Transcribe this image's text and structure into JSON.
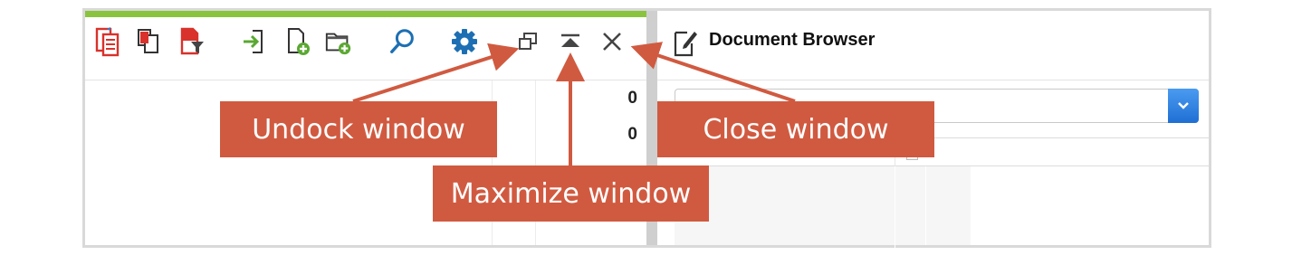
{
  "left_panel": {
    "counts": [
      "0",
      "0"
    ],
    "toolbar_icons": [
      "document-list-icon",
      "copy-documents-icon",
      "filter-documents-icon",
      "import-icon",
      "new-document-icon",
      "new-folder-icon",
      "search-icon",
      "settings-gear-icon",
      "undock-icon",
      "maximize-icon",
      "close-icon"
    ]
  },
  "document_browser": {
    "title": "Document Browser",
    "icon": "edit-document-icon",
    "dropdown_value": ""
  },
  "annotations": {
    "undock": "Undock window",
    "maximize": "Maximize window",
    "close": "Close window"
  },
  "colors": {
    "accent_green": "#8ac43e",
    "annotation_red": "#d05a40",
    "icon_red": "#d9312b",
    "icon_green": "#5aa832",
    "icon_blue": "#1d6fb3"
  }
}
